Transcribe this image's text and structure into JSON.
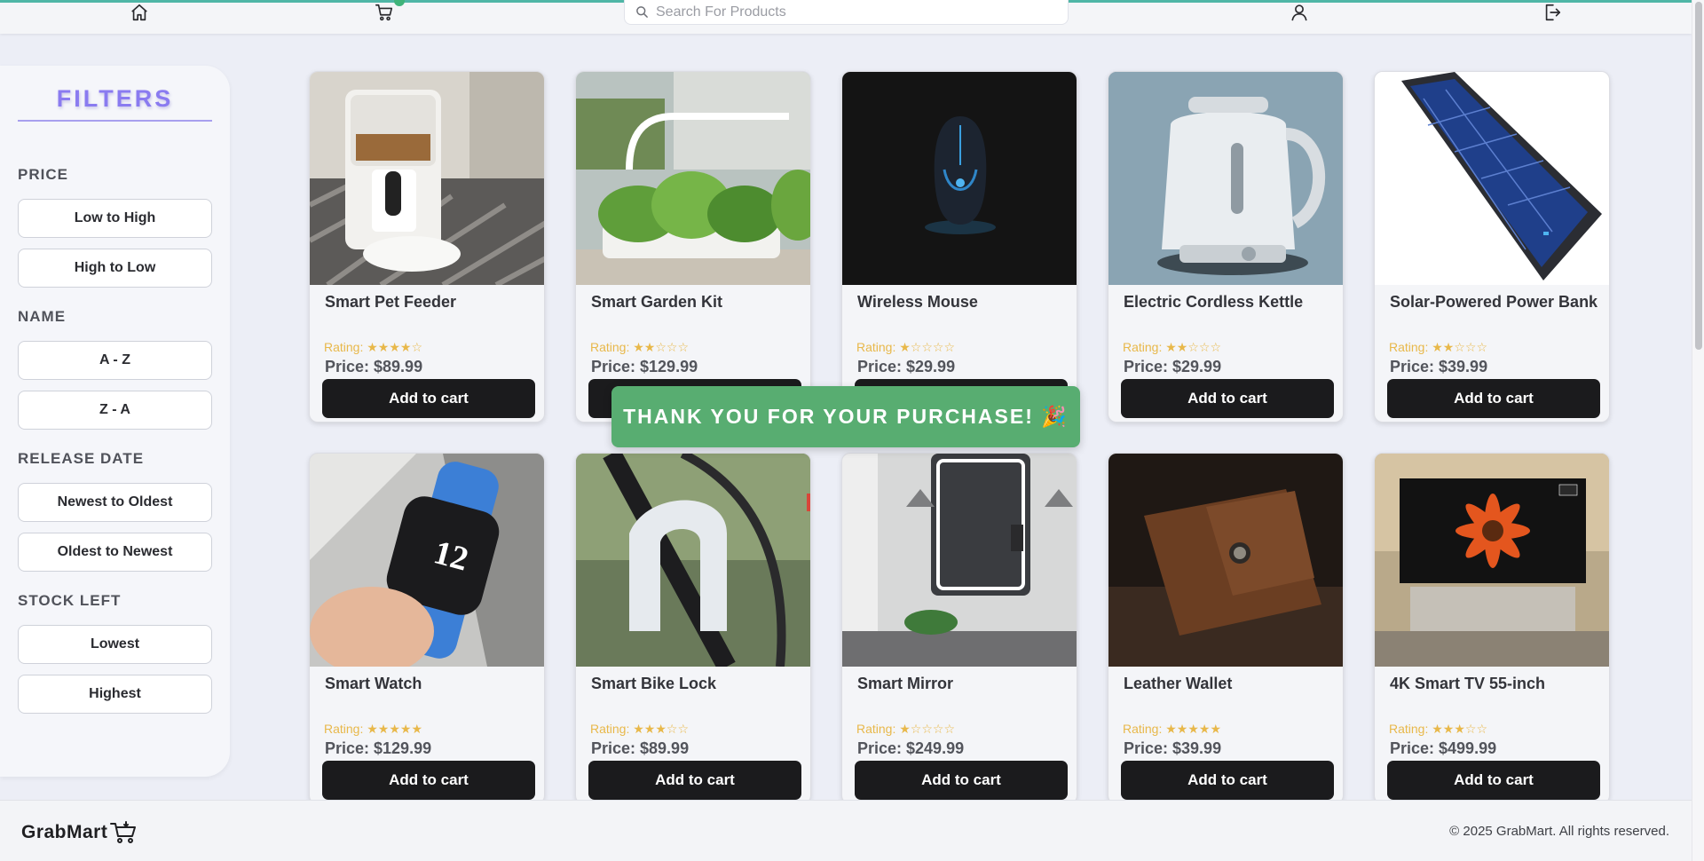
{
  "navbar": {
    "icons": [
      "home-icon",
      "cart-icon",
      "user-icon",
      "logout-icon"
    ],
    "search_placeholder": "Search For Products",
    "accent_color": "#4fb6a6"
  },
  "filters": {
    "title": "FILTERS",
    "sections": [
      {
        "heading": "PRICE",
        "options": [
          "Low to High",
          "High to Low"
        ]
      },
      {
        "heading": "NAME",
        "options": [
          "A - Z",
          "Z - A"
        ]
      },
      {
        "heading": "RELEASE DATE",
        "options": [
          "Newest to Oldest",
          "Oldest to Newest"
        ]
      },
      {
        "heading": "STOCK LEFT",
        "options": [
          "Lowest",
          "Highest"
        ]
      }
    ]
  },
  "products": [
    {
      "name": "Smart Pet Feeder",
      "rating_label": "Rating:",
      "stars": "★★★★☆",
      "rating": 4,
      "price": "Price: $89.99",
      "button": "Add to cart"
    },
    {
      "name": "Smart Garden Kit",
      "rating_label": "Rating:",
      "stars": "★★☆☆☆",
      "rating": 2,
      "price": "Price: $129.99",
      "button": "Add to cart"
    },
    {
      "name": "Wireless Mouse",
      "rating_label": "Rating:",
      "stars": "★☆☆☆☆",
      "rating": 1,
      "price": "Price: $29.99",
      "button": "Add to cart"
    },
    {
      "name": "Electric Cordless Kettle",
      "rating_label": "Rating:",
      "stars": "★★☆☆☆",
      "rating": 2,
      "price": "Price: $29.99",
      "button": "Add to cart"
    },
    {
      "name": "Solar-Powered Power Bank",
      "rating_label": "Rating:",
      "stars": "★★☆☆☆",
      "rating": 2,
      "price": "Price: $39.99",
      "button": "Add to cart"
    },
    {
      "name": "Smart Watch",
      "rating_label": "Rating:",
      "stars": "★★★★★",
      "rating": 5,
      "price": "Price: $129.99",
      "button": "Add to cart"
    },
    {
      "name": "Smart Bike Lock",
      "rating_label": "Rating:",
      "stars": "★★★☆☆",
      "rating": 3,
      "price": "Price: $89.99",
      "button": "Add to cart"
    },
    {
      "name": "Smart Mirror",
      "rating_label": "Rating:",
      "stars": "★☆☆☆☆",
      "rating": 1,
      "price": "Price: $249.99",
      "button": "Add to cart"
    },
    {
      "name": "Leather Wallet",
      "rating_label": "Rating:",
      "stars": "★★★★★",
      "rating": 5,
      "price": "Price: $39.99",
      "button": "Add to cart"
    },
    {
      "name": "4K Smart TV 55-inch",
      "rating_label": "Rating:",
      "stars": "★★★☆☆",
      "rating": 3,
      "price": "Price: $499.99",
      "button": "Add to cart"
    }
  ],
  "toast": {
    "message": "THANK YOU FOR YOUR PURCHASE! 🎉",
    "color": "#58ad71"
  },
  "footer": {
    "brand": "GrabMart",
    "copyright": "© 2025 GrabMart. All rights reserved."
  },
  "colors": {
    "background": "#eceef6",
    "button": "#1b1b1d",
    "rating_star": "#e8b84a",
    "filters_title": "#8a7bf0"
  }
}
